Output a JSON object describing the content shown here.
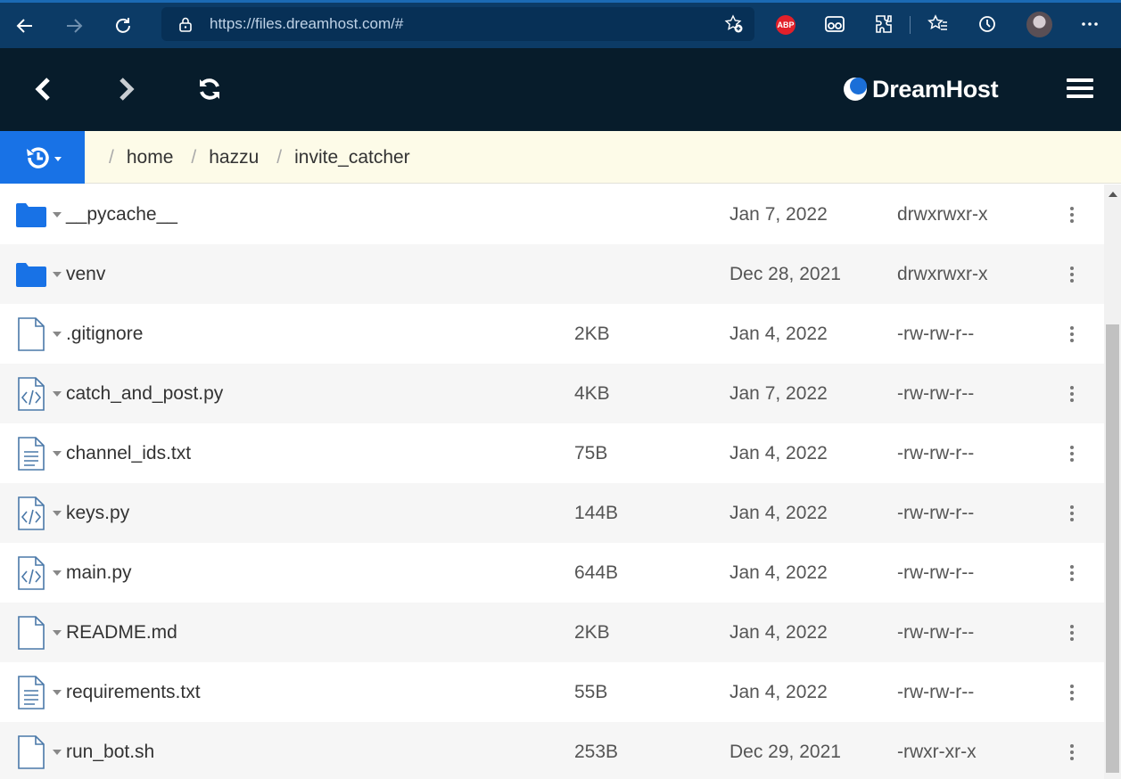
{
  "browser": {
    "url": "https://files.dreamhost.com/#",
    "abp_label": "ABP"
  },
  "app": {
    "logo_text": "DreamHost"
  },
  "breadcrumb": {
    "items": [
      "home",
      "hazzu",
      "invite_catcher"
    ],
    "separator": "/"
  },
  "files": [
    {
      "name": "__pycache__",
      "type": "folder",
      "size": "",
      "date": "Jan 7, 2022",
      "perm": "drwxrwxr-x"
    },
    {
      "name": "venv",
      "type": "folder",
      "size": "",
      "date": "Dec 28, 2021",
      "perm": "drwxrwxr-x"
    },
    {
      "name": ".gitignore",
      "type": "file",
      "size": "2KB",
      "date": "Jan 4, 2022",
      "perm": "-rw-rw-r--"
    },
    {
      "name": "catch_and_post.py",
      "type": "code",
      "size": "4KB",
      "date": "Jan 7, 2022",
      "perm": "-rw-rw-r--"
    },
    {
      "name": "channel_ids.txt",
      "type": "text",
      "size": "75B",
      "date": "Jan 4, 2022",
      "perm": "-rw-rw-r--"
    },
    {
      "name": "keys.py",
      "type": "code",
      "size": "144B",
      "date": "Jan 4, 2022",
      "perm": "-rw-rw-r--"
    },
    {
      "name": "main.py",
      "type": "code",
      "size": "644B",
      "date": "Jan 4, 2022",
      "perm": "-rw-rw-r--"
    },
    {
      "name": "README.md",
      "type": "file",
      "size": "2KB",
      "date": "Jan 4, 2022",
      "perm": "-rw-rw-r--"
    },
    {
      "name": "requirements.txt",
      "type": "text",
      "size": "55B",
      "date": "Jan 4, 2022",
      "perm": "-rw-rw-r--"
    },
    {
      "name": "run_bot.sh",
      "type": "file",
      "size": "253B",
      "date": "Dec 29, 2021",
      "perm": "-rwxr-xr-x"
    }
  ],
  "colors": {
    "browser_bar": "#0c3b66",
    "app_header": "#071c2b",
    "accent_blue": "#1872e6",
    "breadcrumb_bg": "#fdfbe8"
  }
}
